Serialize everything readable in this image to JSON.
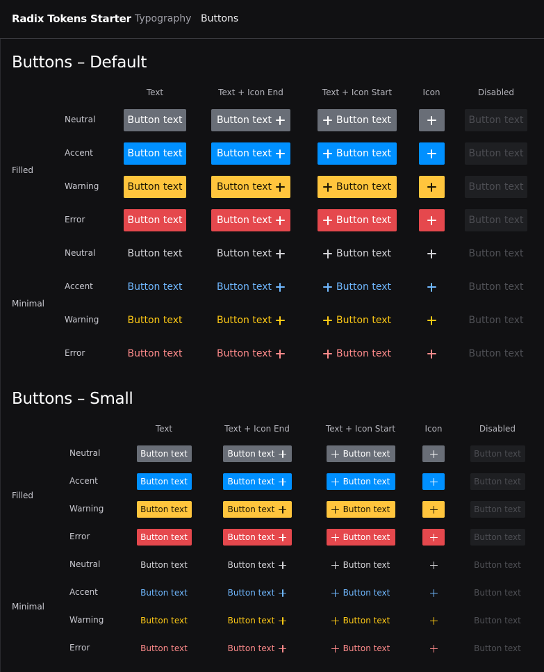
{
  "nav": {
    "brand": "Radix Tokens Starter",
    "links": [
      "Typography",
      "Buttons"
    ]
  },
  "sections": [
    {
      "title": "Buttons – Default",
      "columns": [
        "Text",
        "Text + Icon End",
        "Text + Icon Start",
        "Icon",
        "Disabled"
      ],
      "groups": [
        "Filled",
        "Minimal"
      ],
      "rows": [
        "Neutral",
        "Accent",
        "Warning",
        "Error"
      ],
      "button_text": "Button text"
    },
    {
      "title": "Buttons – Small",
      "columns": [
        "Text",
        "Text + Icon End",
        "Text + Icon Start",
        "Icon",
        "Disabled"
      ],
      "groups": [
        "Filled",
        "Minimal"
      ],
      "rows": [
        "Neutral",
        "Accent",
        "Warning",
        "Error"
      ],
      "button_text": "Button text"
    }
  ],
  "icons": {
    "button_icon": "plus-icon"
  },
  "colors": {
    "background": "#111113",
    "neutral_fill": "#696e77",
    "accent_fill": "#0090ff",
    "warning_fill": "#ffc53d",
    "error_fill": "#e5484d",
    "disabled_fill": "#1e1f22",
    "neutral_text": "#d4d4d8",
    "accent_text": "#70b8ff",
    "warning_text": "#ffca16",
    "error_text": "#ff8b8b",
    "disabled_text": "#4f5055"
  }
}
